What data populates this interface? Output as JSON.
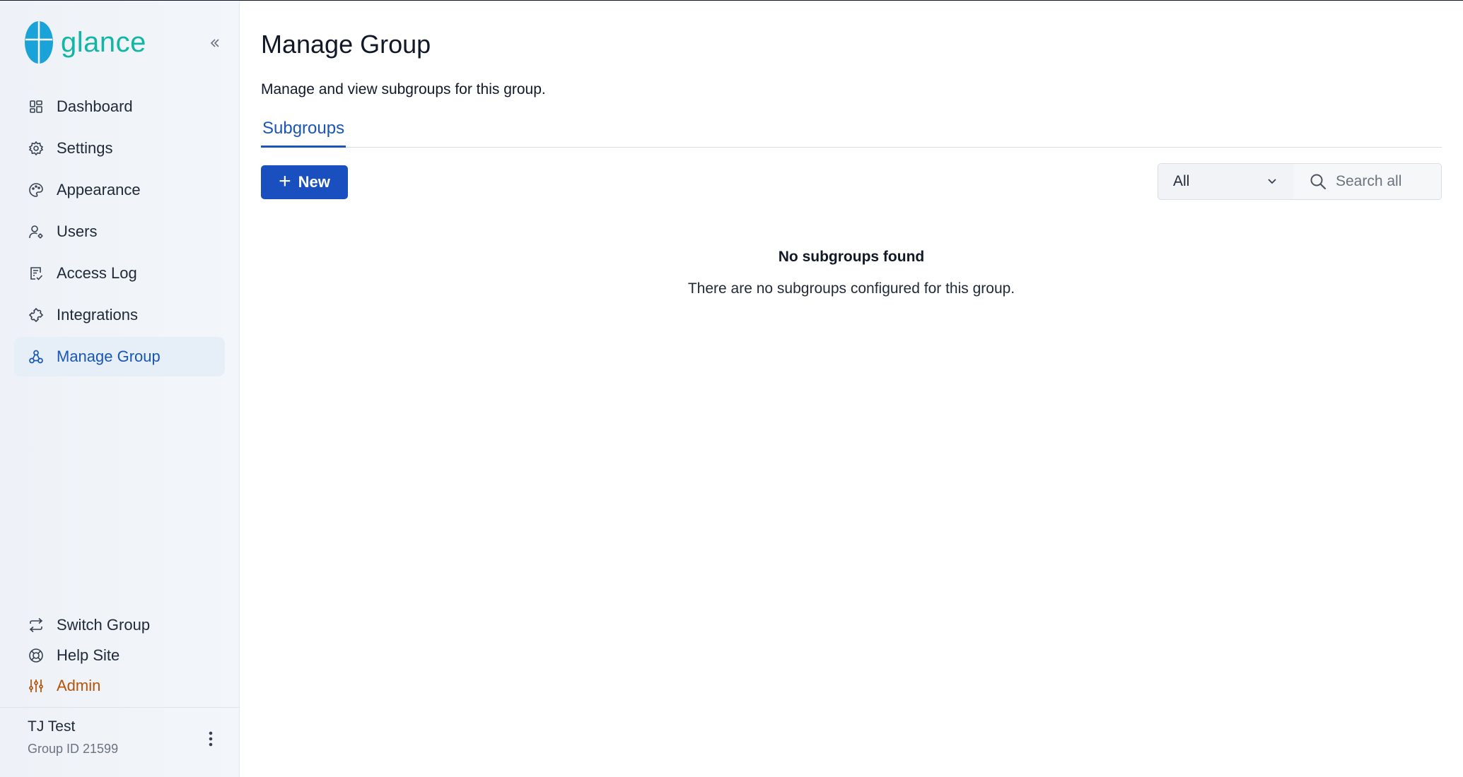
{
  "app": {
    "name": "glance",
    "brand_color": "#13b5a6",
    "accent_color": "#1a56b5"
  },
  "sidebar": {
    "collapse_icon": "double-chevron-left-icon",
    "items": [
      {
        "label": "Dashboard",
        "icon": "dashboard-icon",
        "active": false
      },
      {
        "label": "Settings",
        "icon": "gear-icon",
        "active": false
      },
      {
        "label": "Appearance",
        "icon": "palette-icon",
        "active": false
      },
      {
        "label": "Users",
        "icon": "user-settings-icon",
        "active": false
      },
      {
        "label": "Access Log",
        "icon": "log-icon",
        "active": false
      },
      {
        "label": "Integrations",
        "icon": "puzzle-icon",
        "active": false
      },
      {
        "label": "Manage Group",
        "icon": "group-icon",
        "active": true
      }
    ],
    "bottom_items": [
      {
        "label": "Switch Group",
        "icon": "switch-icon"
      },
      {
        "label": "Help Site",
        "icon": "lifebuoy-icon"
      },
      {
        "label": "Admin",
        "icon": "sliders-icon",
        "color": "#b45309"
      }
    ],
    "user": {
      "name": "TJ Test",
      "group_id": "Group ID 21599"
    }
  },
  "main": {
    "title": "Manage Group",
    "subtitle": "Manage and view subgroups for this group.",
    "tabs": [
      {
        "label": "Subgroups",
        "active": true
      }
    ],
    "toolbar": {
      "new_label": "New",
      "filter_value": "All",
      "search_placeholder": "Search all"
    },
    "empty": {
      "title": "No subgroups found",
      "description": "There are no subgroups configured for this group."
    }
  }
}
